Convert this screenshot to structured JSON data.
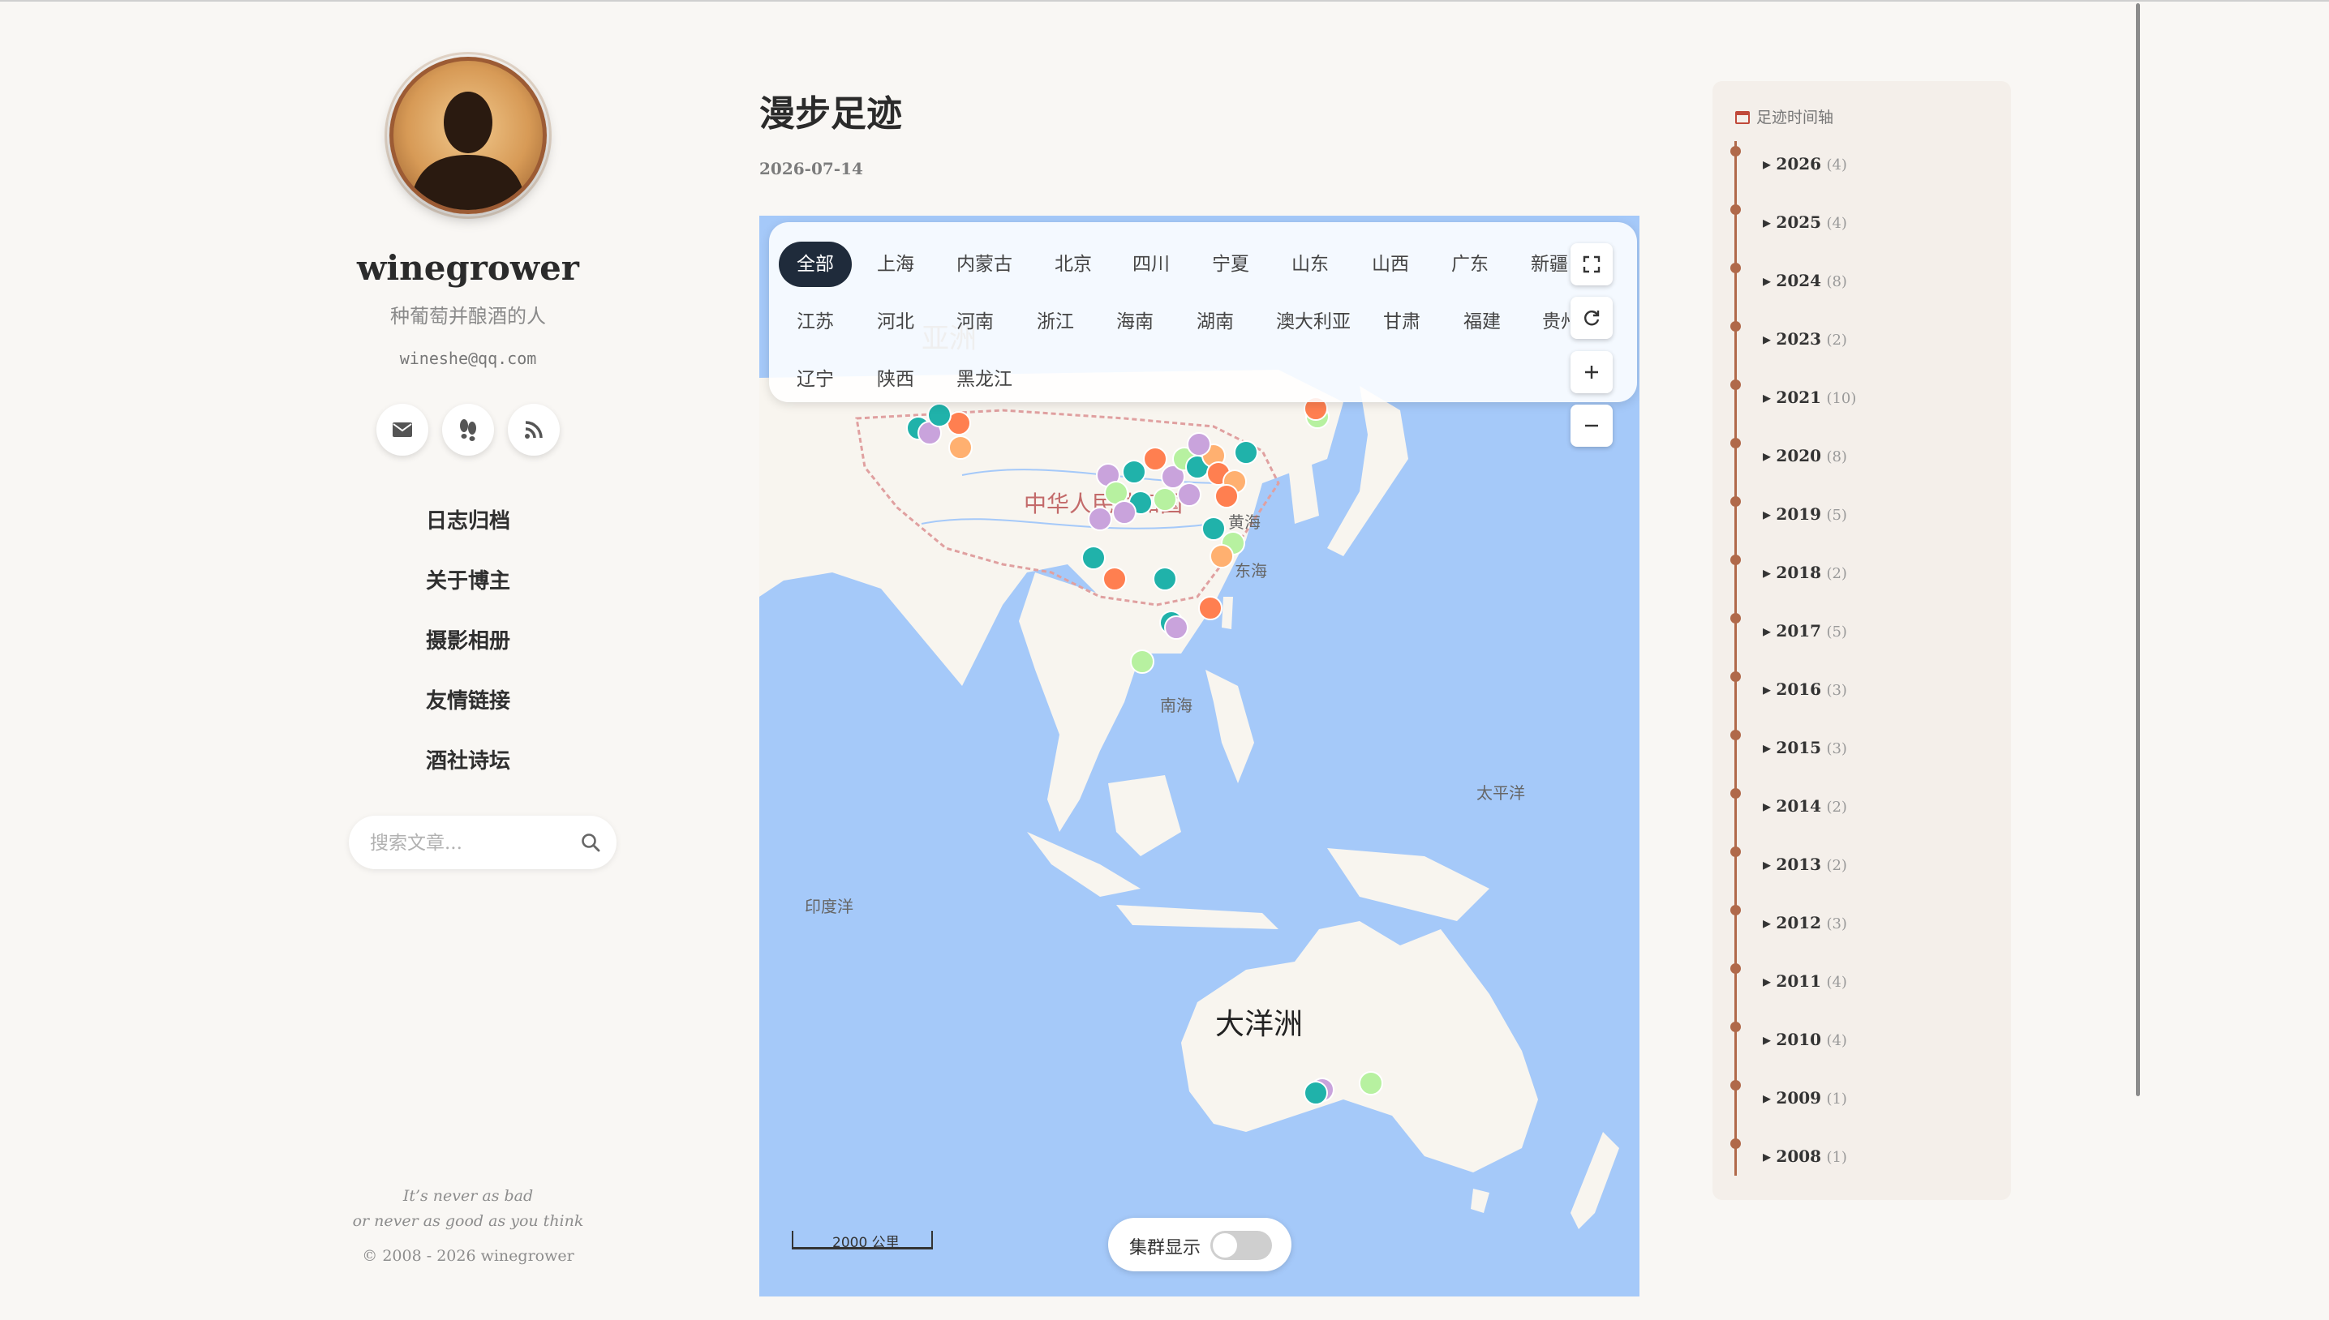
{
  "sidebar": {
    "author": "winegrower",
    "subtitle": "种葡萄并酿酒的人",
    "email": "wineshe@qq.com",
    "social": [
      {
        "icon": "mail-icon"
      },
      {
        "icon": "footprints-icon"
      },
      {
        "icon": "rss-icon"
      }
    ],
    "nav": [
      "日志归档",
      "关于博主",
      "摄影相册",
      "友情链接",
      "酒社诗坛"
    ],
    "search_placeholder": "搜索文章...",
    "quote_line1": "It’s never as bad",
    "quote_line2": "or never as good as you think",
    "copyright": "© 2008 - 2026 winegrower"
  },
  "main": {
    "title": "漫步足迹",
    "date": "2026-07-14"
  },
  "map": {
    "filters": [
      "全部",
      "上海",
      "内蒙古",
      "北京",
      "四川",
      "宁夏",
      "山东",
      "山西",
      "广东",
      "新疆",
      "江苏",
      "河北",
      "河南",
      "浙江",
      "海南",
      "湖南",
      "澳大利亚",
      "甘肃",
      "福建",
      "贵州",
      "辽宁",
      "陕西",
      "黑龙江"
    ],
    "active_filter": "全部",
    "labels": {
      "asia": "亚洲",
      "china": "中华人民共和国",
      "yellow_sea": "黄海",
      "east_sea": "东海",
      "south_sea": "南海",
      "pacific": "太平洋",
      "indian": "印度洋",
      "oceania": "大洋洲"
    },
    "scale_label": "2000 公里",
    "cluster_label": "集群显示",
    "cluster_enabled": false,
    "colors": {
      "water": "#a5c9f9",
      "land": "#f8f5ef",
      "border": "#e0a0a0"
    },
    "marker_colors": [
      "#20b2aa",
      "#ff7f50",
      "#c9a3dc",
      "#b7f1a0",
      "#ffb070"
    ]
  },
  "timeline": {
    "title": "足迹时间轴",
    "icon": "calendar-icon",
    "years": [
      {
        "year": "2026",
        "count": "(4)"
      },
      {
        "year": "2025",
        "count": "(4)"
      },
      {
        "year": "2024",
        "count": "(8)"
      },
      {
        "year": "2023",
        "count": "(2)"
      },
      {
        "year": "2021",
        "count": "(10)"
      },
      {
        "year": "2020",
        "count": "(8)"
      },
      {
        "year": "2019",
        "count": "(5)"
      },
      {
        "year": "2018",
        "count": "(2)"
      },
      {
        "year": "2017",
        "count": "(5)"
      },
      {
        "year": "2016",
        "count": "(3)"
      },
      {
        "year": "2015",
        "count": "(3)"
      },
      {
        "year": "2014",
        "count": "(2)"
      },
      {
        "year": "2013",
        "count": "(2)"
      },
      {
        "year": "2012",
        "count": "(3)"
      },
      {
        "year": "2011",
        "count": "(4)"
      },
      {
        "year": "2010",
        "count": "(4)"
      },
      {
        "year": "2009",
        "count": "(1)"
      },
      {
        "year": "2008",
        "count": "(1)"
      }
    ]
  }
}
